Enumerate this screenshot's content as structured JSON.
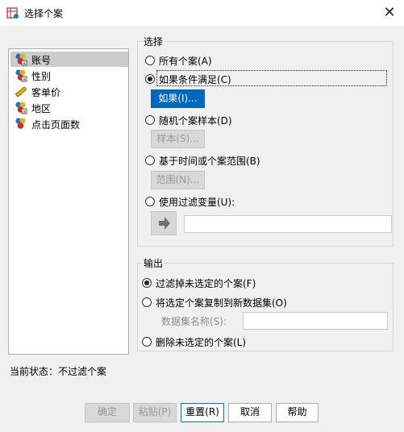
{
  "window": {
    "title": "选择个案",
    "close_glyph": "✕"
  },
  "variables": [
    {
      "label": "账号",
      "icon": "nominal-variable-icon",
      "selected": true
    },
    {
      "label": "性别",
      "icon": "nominal-variable-icon",
      "selected": false
    },
    {
      "label": "客单价",
      "icon": "scale-ruler-icon",
      "selected": false
    },
    {
      "label": "地区",
      "icon": "nominal-variable-icon",
      "selected": false
    },
    {
      "label": "点击页面数",
      "icon": "ordinal-variable-icon",
      "selected": false
    }
  ],
  "select_group": {
    "title": "选择",
    "options": {
      "all": "所有个案(A)",
      "if_condition": "如果条件满足(C)",
      "random": "随机个案样本(D)",
      "range": "基于时间或个案范围(B)",
      "filter_var": "使用过滤变量(U):"
    },
    "selected": "if_condition",
    "if_button": "如果(I)...",
    "sample_button": "样本(S)...",
    "range_button": "范围(N)..."
  },
  "output_group": {
    "title": "输出",
    "options": {
      "filter_out": "过滤掉未选定的个案(F)",
      "copy_new": "将选定个案复制到新数据集(O)",
      "delete": "删除未选定的个案(L)"
    },
    "selected": "filter_out",
    "dataset_name_label": "数据集名称(S):",
    "dataset_name_value": ""
  },
  "status": "当前状态：不过滤个案",
  "buttons": {
    "ok": "确定",
    "paste": "粘贴(P)",
    "reset": "重置(R)",
    "cancel": "取消",
    "help": "帮助"
  },
  "colors": {
    "accent": "#0067c0",
    "selection": "#cccccc",
    "background": "#f0f0f0"
  }
}
